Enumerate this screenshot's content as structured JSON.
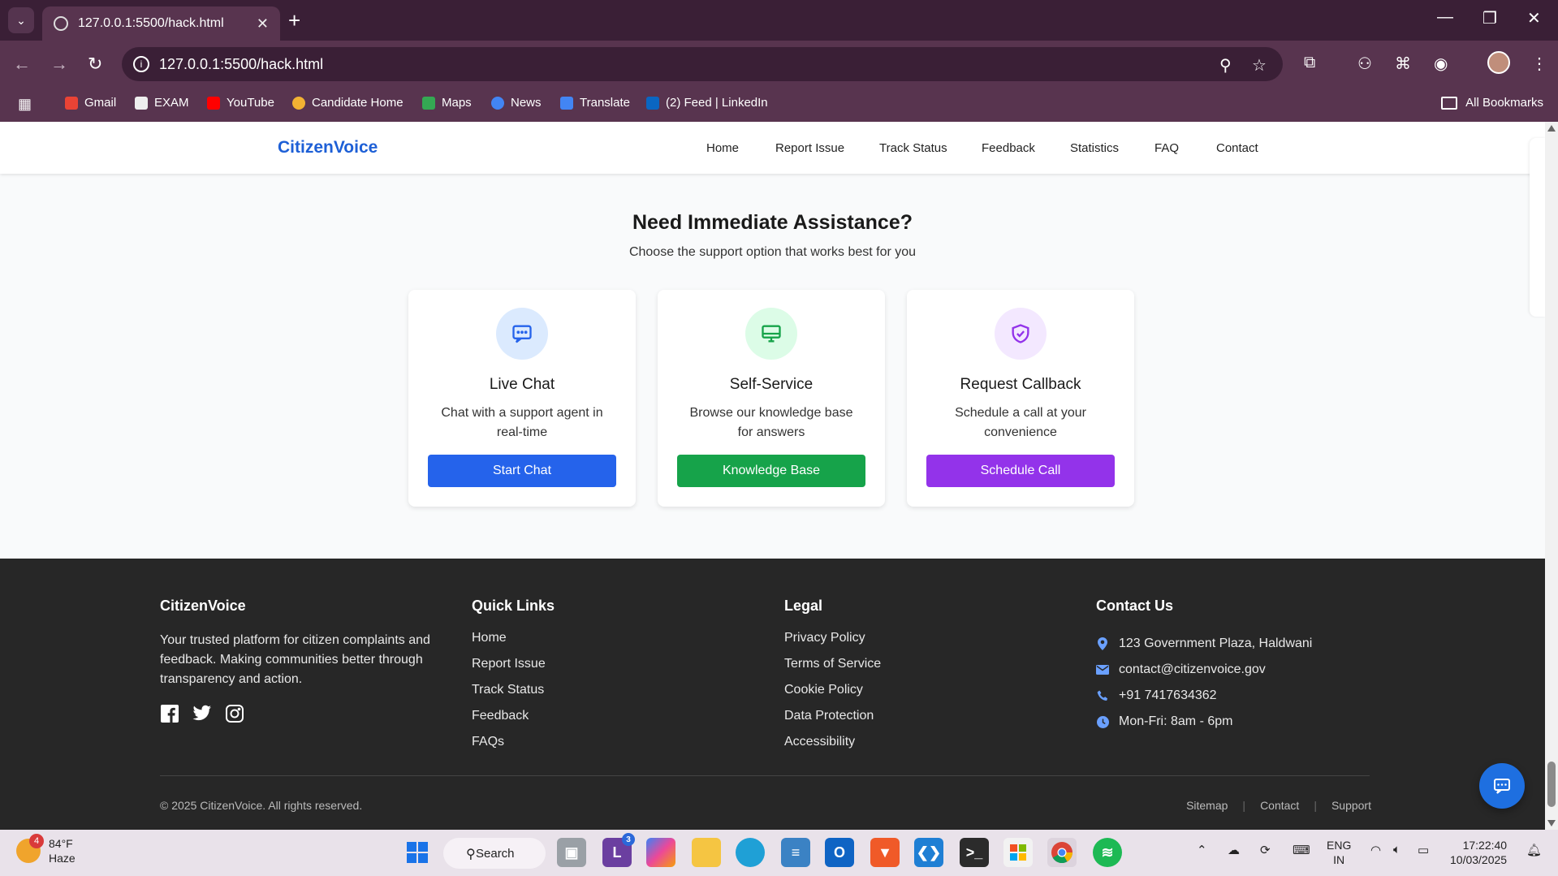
{
  "browser": {
    "tab_title": "127.0.0.1:5500/hack.html",
    "url": "127.0.0.1:5500/hack.html",
    "bookmarks": [
      "Gmail",
      "EXAM",
      "YouTube",
      "Candidate Home",
      "Maps",
      "News",
      "Translate",
      "(2) Feed | LinkedIn"
    ],
    "all_bookmarks": "All Bookmarks"
  },
  "site": {
    "brand": "CitizenVoice",
    "nav": [
      "Home",
      "Report Issue",
      "Track Status",
      "Feedback",
      "Statistics",
      "FAQ",
      "Contact"
    ]
  },
  "assist": {
    "title": "Need Immediate Assistance?",
    "subtitle": "Choose the support option that works best for you",
    "cards": [
      {
        "title": "Live Chat",
        "desc": "Chat with a support agent in real-time",
        "button": "Start Chat",
        "color": "#2563eb",
        "bg": "#dbeafe",
        "icon": "chat-icon"
      },
      {
        "title": "Self-Service",
        "desc": "Browse our knowledge base for answers",
        "button": "Knowledge Base",
        "color": "#16a34a",
        "bg": "#dcfce7",
        "icon": "monitor-icon"
      },
      {
        "title": "Request Callback",
        "desc": "Schedule a call at your convenience",
        "button": "Schedule Call",
        "color": "#9333ea",
        "bg": "#f3e8ff",
        "icon": "shield-check-icon"
      }
    ]
  },
  "footer": {
    "about": {
      "heading": "CitizenVoice",
      "text": "Your trusted platform for citizen complaints and feedback. Making communities better through transparency and action."
    },
    "quick_links": {
      "heading": "Quick Links",
      "items": [
        "Home",
        "Report Issue",
        "Track Status",
        "Feedback",
        "FAQs"
      ]
    },
    "legal": {
      "heading": "Legal",
      "items": [
        "Privacy Policy",
        "Terms of Service",
        "Cookie Policy",
        "Data Protection",
        "Accessibility"
      ]
    },
    "contact": {
      "heading": "Contact Us",
      "address": "123 Government Plaza, Haldwani",
      "email": "contact@citizenvoice.gov",
      "phone": "+91 7417634362",
      "hours": "Mon-Fri: 8am - 6pm"
    },
    "copyright": "© 2025 CitizenVoice. All rights reserved.",
    "bottom_links": [
      "Sitemap",
      "Contact",
      "Support"
    ]
  },
  "taskbar": {
    "weather_temp": "84°F",
    "weather_cond": "Haze",
    "weather_badge": "4",
    "search": "Search",
    "lang_1": "ENG",
    "lang_2": "IN",
    "time": "17:22:40",
    "date": "10/03/2025",
    "notif_badge": "3"
  }
}
